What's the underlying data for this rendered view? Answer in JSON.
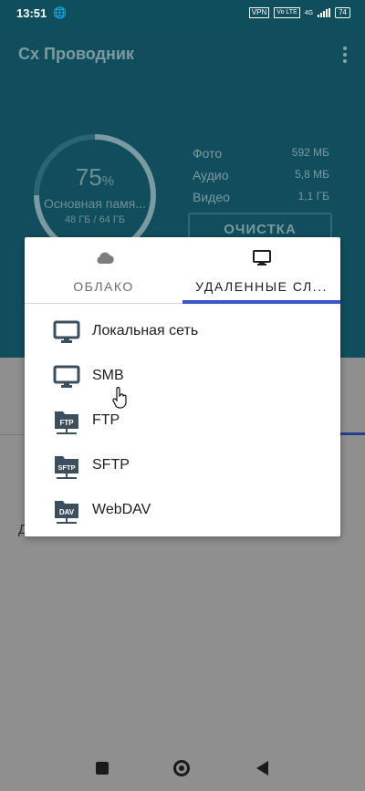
{
  "status_bar": {
    "time": "13:51",
    "vpn": "VPN",
    "volte": "Vo LTE",
    "network": "4G",
    "battery": "74"
  },
  "app": {
    "title": "Cx Проводник"
  },
  "storage": {
    "percent": "75",
    "percent_sign": "%",
    "label": "Основная памя...",
    "usage": "48 ГБ / 64 ГБ",
    "percent_value": 75,
    "stats": [
      {
        "label": "Фото",
        "value": "592 МБ"
      },
      {
        "label": "Аудио",
        "value": "5,8 МБ"
      },
      {
        "label": "Видео",
        "value": "1,1 ГБ"
      }
    ],
    "clean_button": "ОЧИСТКА"
  },
  "background_letter": "Д",
  "modal": {
    "tabs": [
      {
        "label": "ОБЛАКО",
        "icon": "cloud-icon",
        "selected": false
      },
      {
        "label": "УДАЛЕННЫЕ СЛ...",
        "icon": "monitor-icon",
        "selected": true
      }
    ],
    "items": [
      {
        "label": "Локальная сеть",
        "icon": "monitor-icon"
      },
      {
        "label": "SMB",
        "icon": "monitor-icon"
      },
      {
        "label": "FTP",
        "icon": "ftp-folder-icon",
        "badge": "FTP"
      },
      {
        "label": "SFTP",
        "icon": "sftp-folder-icon",
        "badge": "SFTP"
      },
      {
        "label": "WebDAV",
        "icon": "dav-folder-icon",
        "badge": "DAV"
      }
    ]
  },
  "colors": {
    "header_bg": "#114e5d",
    "accent": "#3b56c8",
    "icon": "#3d4f5c"
  }
}
